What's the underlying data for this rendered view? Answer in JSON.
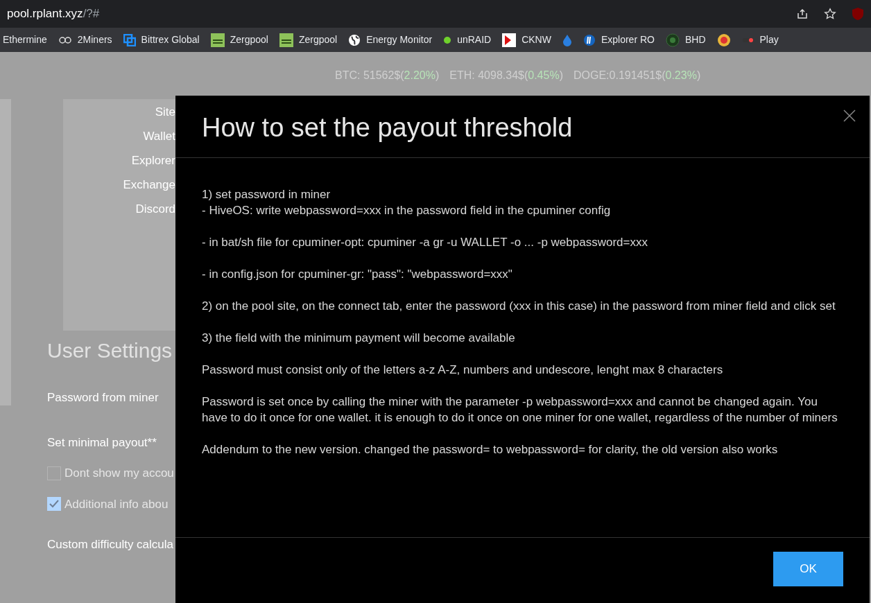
{
  "browser": {
    "url_host": "pool.rplant.xyz",
    "url_path": "/?#"
  },
  "bookmarks": [
    {
      "label": "Ethermine",
      "kind": "text"
    },
    {
      "label": "2Miners",
      "kind": "glasses"
    },
    {
      "label": "Bittrex Global",
      "kind": "squares"
    },
    {
      "label": "Zergpool",
      "kind": "zerg"
    },
    {
      "label": "Zergpool",
      "kind": "zerg"
    },
    {
      "label": "Energy Monitor",
      "kind": "globe"
    },
    {
      "label": "unRAID",
      "kind": "dot"
    },
    {
      "label": "CKNW",
      "kind": "flag"
    },
    {
      "kind": "drop"
    },
    {
      "label": "Explorer RO",
      "kind": "coin"
    },
    {
      "label": "BHD",
      "kind": "vlp"
    },
    {
      "kind": "badge"
    },
    {
      "label": "Play",
      "kind": "play"
    }
  ],
  "ticker": [
    {
      "label": "BTC: 51562$(",
      "change": "2.20%",
      "end": ")"
    },
    {
      "label": "ETH: 4098.34$(",
      "change": "0.45%",
      "end": ")"
    },
    {
      "label": "DOGE:0.191451$(",
      "change": "0.23%",
      "end": ")"
    }
  ],
  "nav_links": [
    "Site",
    "Wallet",
    "Explorer",
    "Exchange",
    "Discord"
  ],
  "user_settings": {
    "title": "User Settings",
    "password_label": "Password from miner",
    "payout_label": "Set minimal payout**",
    "options": [
      {
        "label": "Dont show my accou",
        "checked": false
      },
      {
        "label": "Additional info abou",
        "checked": true
      }
    ],
    "difficulty_label": "Custom difficulty calcula"
  },
  "modal": {
    "title": "How to set the payout threshold",
    "paragraphs": [
      [
        "1) set password in miner",
        "- HiveOS: write webpassword=xxx in the password field in the cpuminer config"
      ],
      [
        "- in bat/sh file for cpuminer-opt: cpuminer -a gr -u WALLET -o ... -p webpassword=xxx"
      ],
      [
        "- in config.json for cpuminer-gr: \"pass\": \"webpassword=xxx\""
      ],
      [
        "2) on the pool site, on the connect tab, enter the password (xxx in this case) in the password from miner field and click set"
      ],
      [
        "3) the field with the minimum payment will become available"
      ],
      [
        "Password must consist only of the letters a-z A-Z, numbers and undescore, lenght max 8 characters"
      ],
      [
        "Password is set once by calling the miner with the parameter -p webpassword=xxx and cannot be changed again. You have to do it once for one wallet. it is enough to do it once on one miner for one wallet, regardless of the number of miners"
      ],
      [
        "Addendum to the new version. changed the password= to webpassword= for clarity, the old version also works"
      ]
    ],
    "ok_button": "OK"
  }
}
